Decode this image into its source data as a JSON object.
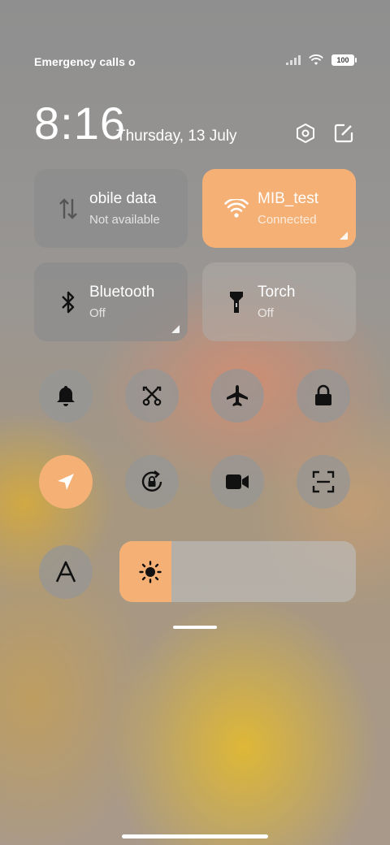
{
  "status_bar": {
    "carrier_text": "Emergency calls o",
    "battery_level": "100"
  },
  "header": {
    "time": "8:16",
    "date": "Thursday, 13 July",
    "settings_icon": "hexagon-settings-icon",
    "edit_icon": "edit-icon"
  },
  "tiles": {
    "mobile_data": {
      "title": "obile data",
      "subtitle": "Not available",
      "icon": "mobile-data-icon"
    },
    "wifi": {
      "title": "MIB_test",
      "subtitle": "Connected",
      "icon": "wifi-icon"
    },
    "bluetooth": {
      "title": "Bluetooth",
      "subtitle": "Off",
      "icon": "bluetooth-icon"
    },
    "torch": {
      "title": "Torch",
      "subtitle": "Off",
      "icon": "torch-icon"
    }
  },
  "toggles": [
    {
      "name": "bell-icon",
      "active": false
    },
    {
      "name": "screenshot-cut-icon",
      "active": false
    },
    {
      "name": "airplane-icon",
      "active": false
    },
    {
      "name": "lock-icon",
      "active": false
    },
    {
      "name": "location-icon",
      "active": true
    },
    {
      "name": "rotation-lock-icon",
      "active": false
    },
    {
      "name": "video-camera-icon",
      "active": false
    },
    {
      "name": "scan-icon",
      "active": false
    },
    {
      "name": "font-a-icon",
      "active": false
    }
  ],
  "brightness": {
    "level_percent": 22,
    "icon": "sun-icon"
  },
  "colors": {
    "accent": "#f4b075",
    "tile_gray": "#8c8c8c"
  }
}
